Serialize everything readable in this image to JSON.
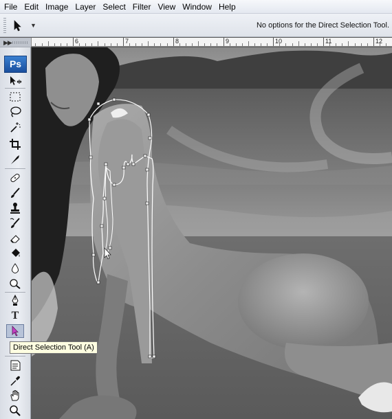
{
  "menu": {
    "items": [
      "File",
      "Edit",
      "Image",
      "Layer",
      "Select",
      "Filter",
      "View",
      "Window",
      "Help"
    ]
  },
  "options_bar": {
    "tool_preset_icon": "arrow-cursor-icon",
    "message": "No options for the Direct Selection Tool."
  },
  "toolbox": {
    "logo": "Ps",
    "tools": [
      {
        "name": "move-tool",
        "icon": "move-icon"
      },
      {
        "name": "marquee-tool",
        "icon": "rect-marquee-icon"
      },
      {
        "name": "lasso-tool",
        "icon": "lasso-icon"
      },
      {
        "name": "magic-wand-tool",
        "icon": "magic-wand-icon"
      },
      {
        "name": "crop-tool",
        "icon": "crop-icon"
      },
      {
        "name": "slice-tool",
        "icon": "slice-icon"
      },
      {
        "name": "healing-brush-tool",
        "icon": "bandage-icon"
      },
      {
        "name": "brush-tool",
        "icon": "brush-icon"
      },
      {
        "name": "clone-stamp-tool",
        "icon": "stamp-icon"
      },
      {
        "name": "history-brush-tool",
        "icon": "history-brush-icon"
      },
      {
        "name": "eraser-tool",
        "icon": "eraser-icon"
      },
      {
        "name": "paint-bucket-tool",
        "icon": "bucket-icon"
      },
      {
        "name": "blur-tool",
        "icon": "drop-icon"
      },
      {
        "name": "dodge-tool",
        "icon": "dodge-icon"
      },
      {
        "name": "pen-tool",
        "icon": "pen-icon"
      },
      {
        "name": "type-tool",
        "icon": "type-icon",
        "glyph": "T"
      },
      {
        "name": "direct-selection-tool",
        "icon": "direct-selection-icon"
      },
      {
        "name": "notes-tool",
        "icon": "note-icon"
      },
      {
        "name": "eyedropper-tool",
        "icon": "eyedropper-icon"
      },
      {
        "name": "hand-tool",
        "icon": "hand-icon"
      },
      {
        "name": "zoom-tool",
        "icon": "zoom-icon"
      }
    ],
    "active_tool": "direct-selection-tool"
  },
  "ruler": {
    "labels": [
      "6",
      "7",
      "8",
      "9",
      "10",
      "11",
      "12"
    ]
  },
  "tooltip": {
    "text": "Direct Selection Tool (A)"
  },
  "colors": {
    "accent": "#1a4f9e",
    "tooltip_bg": "#ffffe1",
    "active_tool_bg": "#b7c3d8"
  }
}
